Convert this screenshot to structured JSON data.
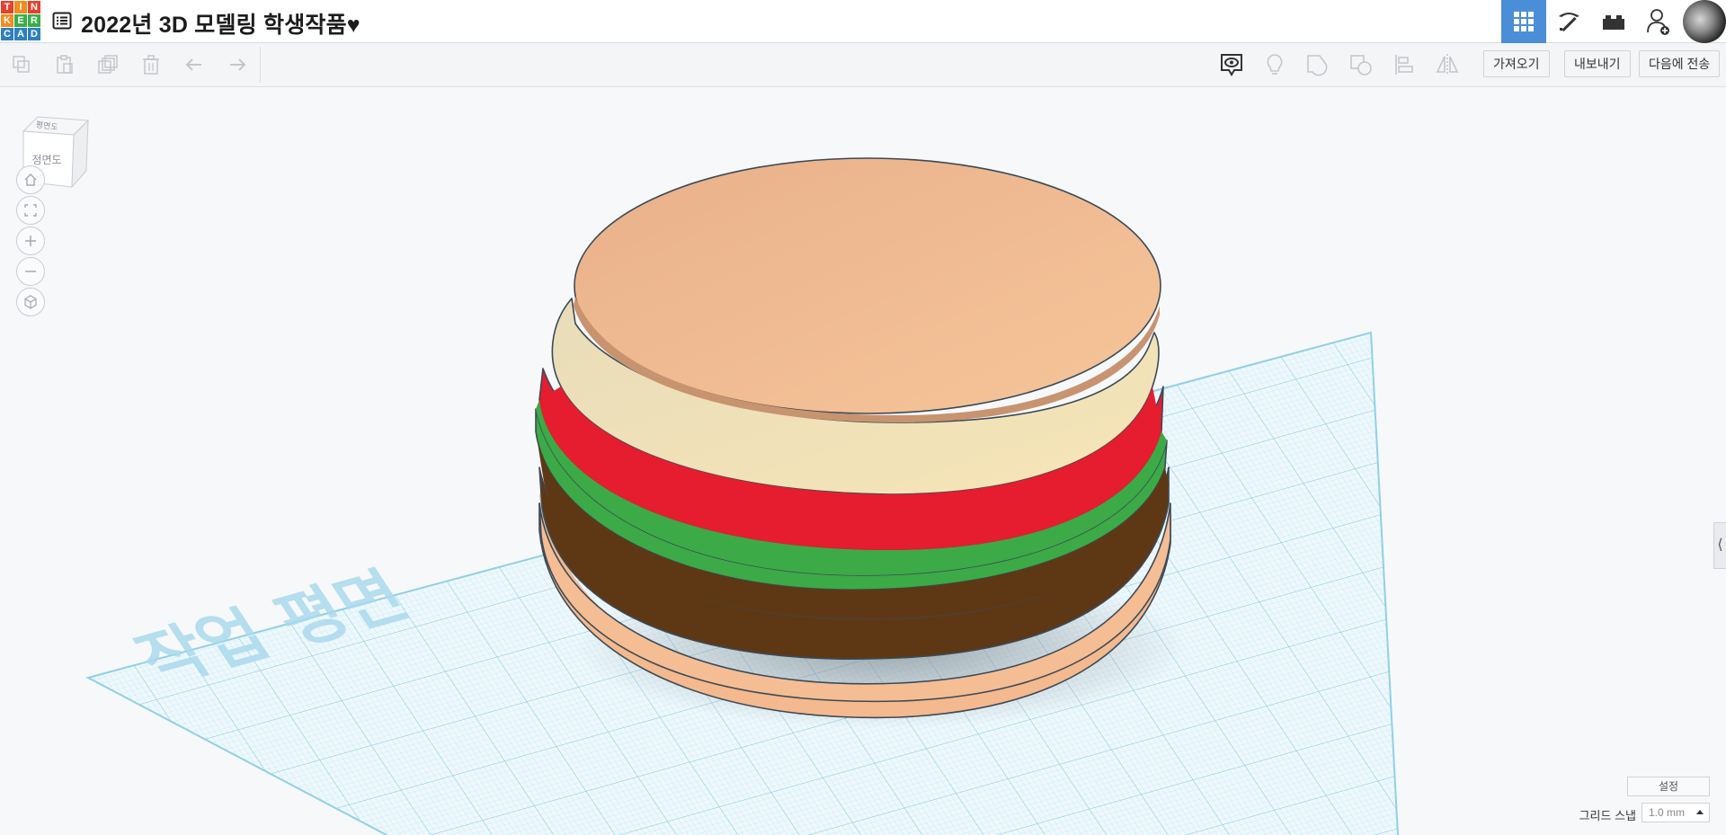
{
  "app": {
    "logo_letters": [
      "T",
      "I",
      "N",
      "K",
      "E",
      "R",
      "C",
      "A",
      "D"
    ],
    "title": "2022년 3D 모델링 학생작품♥"
  },
  "toolbar": {
    "import_label": "가져오기",
    "export_label": "내보내기",
    "send_to_label": "다음에 전송"
  },
  "viewcube": {
    "top_label": "평면도",
    "front_label": "정면도"
  },
  "workplane": {
    "label": "작업 평면"
  },
  "bottom_controls": {
    "settings_label": "설정",
    "grid_snap_label": "그리드 스냅",
    "grid_snap_value": "1.0 mm"
  },
  "model_layers": [
    {
      "name": "bottom-bun",
      "color": "#f4b98e"
    },
    {
      "name": "patty",
      "color": "#5e3815"
    },
    {
      "name": "lettuce",
      "color": "#3caa46"
    },
    {
      "name": "tomato",
      "color": "#e51d2e"
    },
    {
      "name": "cheese",
      "color": "#f2dfb1"
    },
    {
      "name": "top-bun",
      "color": "#f3b888"
    }
  ],
  "colors": {
    "accent": "#4b8ed8",
    "grid": "#bfe4f2"
  }
}
